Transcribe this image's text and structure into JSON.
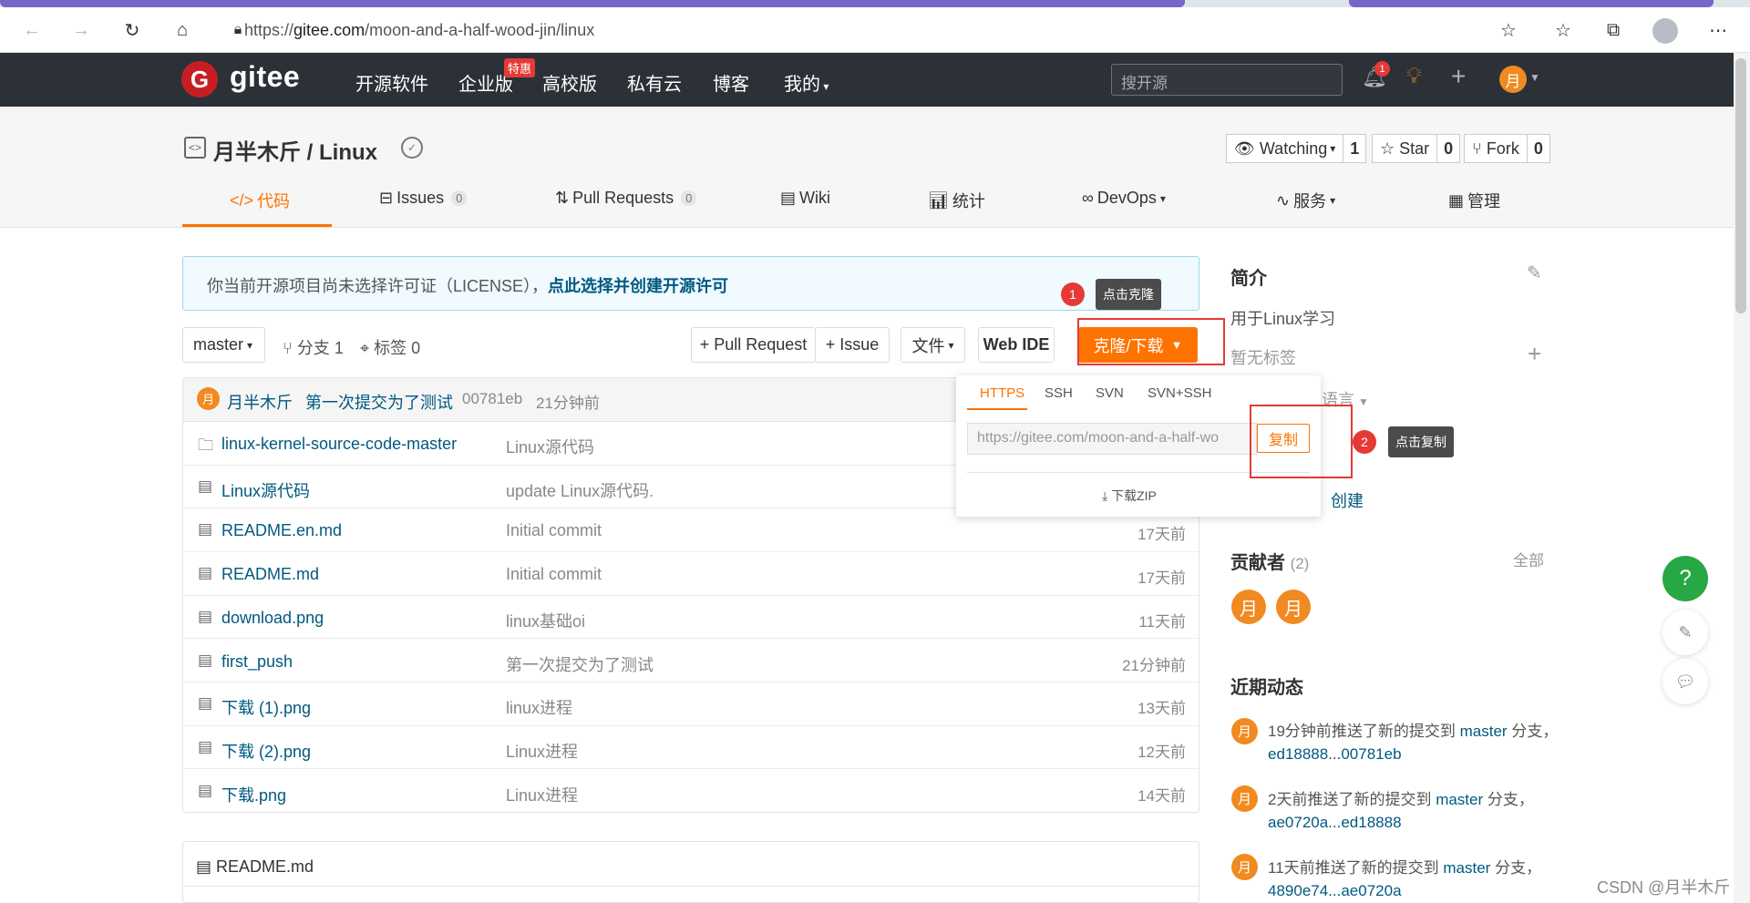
{
  "browser": {
    "url_prefix": "https://",
    "url_host": "gitee.com",
    "url_path": "/moon-and-a-half-wood-jin/linux",
    "icons": [
      "back-icon",
      "forward-icon",
      "reload-icon",
      "home-icon",
      "lock-icon",
      "favorite-add-icon",
      "favorites-icon",
      "collections-icon",
      "profile-icon",
      "more-icon"
    ]
  },
  "header": {
    "logo_letter": "G",
    "logo_text": "gitee",
    "nav": [
      "开源软件",
      "企业版",
      "高校版",
      "私有云",
      "博客",
      "我的"
    ],
    "badge_tehui": "特惠",
    "search_placeholder": "搜开源",
    "notif_count": "1",
    "user_initial": "月"
  },
  "repo": {
    "title": "月半木斤 / Linux",
    "watching_label": "Watching",
    "watching_count": "1",
    "star_label": "Star",
    "star_count": "0",
    "fork_label": "Fork",
    "fork_count": "0",
    "tabs": [
      {
        "label": "代码",
        "icon": "</>"
      },
      {
        "label": "Issues",
        "count": "0"
      },
      {
        "label": "Pull Requests",
        "count": "0"
      },
      {
        "label": "Wiki"
      },
      {
        "label": "统计"
      },
      {
        "label": "DevOps"
      },
      {
        "label": "服务"
      },
      {
        "label": "管理"
      }
    ]
  },
  "license": {
    "text": "你当前开源项目尚未选择许可证（LICENSE），",
    "link": "点此选择并创建开源许可"
  },
  "toolbar": {
    "branch": "master",
    "branches": "分支 1",
    "tags": "标签 0",
    "pull_request": "+ Pull Request",
    "issue": "+ Issue",
    "file": "文件",
    "webide": "Web IDE",
    "clone": "克隆/下载"
  },
  "commit": {
    "avatar": "月",
    "author": "月半木斤",
    "message": "第一次提交为了测试",
    "hash": "00781eb",
    "time": "21分钟前"
  },
  "files": [
    {
      "name": "linux-kernel-source-code-master",
      "type": "folder",
      "message": "Linux源代码",
      "time": ""
    },
    {
      "name": "Linux源代码",
      "type": "file",
      "message": "update Linux源代码.",
      "time": ""
    },
    {
      "name": "README.en.md",
      "type": "file",
      "message": "Initial commit",
      "time": "17天前"
    },
    {
      "name": "README.md",
      "type": "file",
      "message": "Initial commit",
      "time": "17天前"
    },
    {
      "name": "download.png",
      "type": "file",
      "message": "linux基础oi",
      "time": "11天前"
    },
    {
      "name": "first_push",
      "type": "file",
      "message": "第一次提交为了测试",
      "time": "21分钟前"
    },
    {
      "name": "下载 (1).png",
      "type": "file",
      "message": "linux进程",
      "time": "13天前"
    },
    {
      "name": "下载 (2).png",
      "type": "file",
      "message": "Linux进程",
      "time": "12天前"
    },
    {
      "name": "下载.png",
      "type": "file",
      "message": "Linux进程",
      "time": "14天前"
    }
  ],
  "readme_title": "README.md",
  "clone_dropdown": {
    "tabs": [
      "HTTPS",
      "SSH",
      "SVN",
      "SVN+SSH"
    ],
    "url": "https://gitee.com/moon-and-a-half-wo",
    "copy": "复制",
    "zip": "下载ZIP"
  },
  "sidebar": {
    "intro_title": "简介",
    "intro_text": "用于Linux学习",
    "no_tags": "暂无标签",
    "language": "语言",
    "create": "创建",
    "contributors_title": "贡献者",
    "contributors_count": "(2)",
    "contributors_all": "全部",
    "contributors": [
      "月",
      "月"
    ],
    "activity_title": "近期动态",
    "activity": [
      {
        "avatar": "月",
        "pre": "19分钟前推送了新的提交到 ",
        "branch": "master",
        "mid": " 分支，",
        "range": "ed18888...00781eb"
      },
      {
        "avatar": "月",
        "pre": "2天前推送了新的提交到 ",
        "branch": "master",
        "mid": " 分支，",
        "range": "ae0720a...ed18888"
      },
      {
        "avatar": "月",
        "pre": "11天前推送了新的提交到 ",
        "branch": "master",
        "mid": " 分支，",
        "range": "4890e74...ae0720a"
      }
    ]
  },
  "annotations": [
    {
      "num": "1",
      "tip": "点击克隆"
    },
    {
      "num": "2",
      "tip": "点击复制"
    }
  ],
  "watermark": "CSDN @月半木斤",
  "colors": {
    "accent": "#fe7300",
    "header_bg": "#2c3138",
    "link": "#005980",
    "annotation": "#e53935"
  }
}
